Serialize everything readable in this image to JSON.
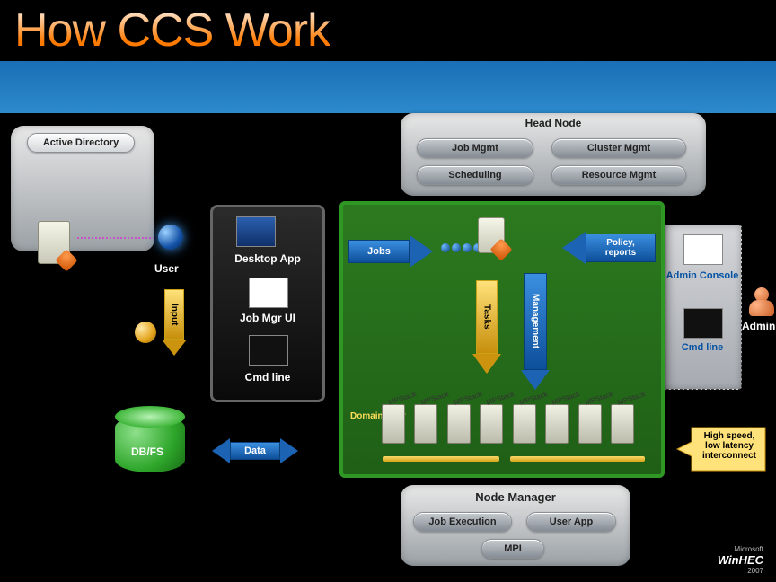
{
  "title": "How CCS Work",
  "active_directory": {
    "label": "Active Directory",
    "user_label": "User"
  },
  "head_node": {
    "title": "Head Node",
    "boxes": {
      "job_mgmt": "Job Mgmt",
      "cluster_mgmt": "Cluster Mgmt",
      "scheduling": "Scheduling",
      "resource_mgmt": "Resource Mgmt"
    }
  },
  "green": {
    "jobs_label": "Jobs",
    "policy_label": "Policy,\nreports",
    "tasks_label": "Tasks",
    "management_label": "Management",
    "domain_user_label": "Domain\\User",
    "cluster_node_tag": "MPStack"
  },
  "left_screen": {
    "desktop_app": "Desktop App",
    "job_mgr_ui": "Job Mgr UI",
    "cmd_line": "Cmd line",
    "input_label": "Input"
  },
  "db": {
    "label": "DB/FS",
    "data_label": "Data"
  },
  "right": {
    "admin_console": "Admin Console",
    "cmd_line": "Cmd line",
    "admin_label": "Admin"
  },
  "interconnect_label": "High speed,\nlow latency\ninterconnect",
  "node_manager": {
    "title": "Node Manager",
    "job_exec": "Job Execution",
    "user_app": "User App",
    "mpi": "MPI"
  },
  "footer": {
    "brand": "WinHEC",
    "vendor": "Microsoft",
    "year": "2007"
  }
}
